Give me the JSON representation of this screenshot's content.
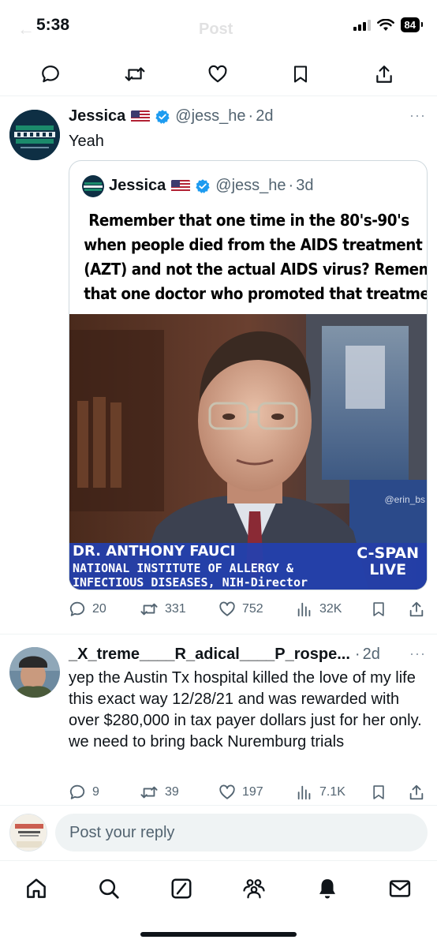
{
  "status_bar": {
    "time": "5:38",
    "battery": "84"
  },
  "ghost_header": {
    "back_glyph": "←",
    "title": "Post"
  },
  "action_bar": {
    "icons": [
      "comment-icon",
      "retweet-icon",
      "like-icon",
      "bookmark-icon",
      "share-icon"
    ]
  },
  "main_tweet": {
    "name": "Jessica",
    "handle": "@jess_he",
    "age": "2d",
    "text": "Yeah",
    "quote": {
      "name": "Jessica",
      "handle": "@jess_he",
      "age": "3d",
      "caption_lines": [
        "Remember that one time in the 80's-90's",
        "when people died from the AIDS treatment",
        "(AZT) and not the actual AIDS virus?  Remember",
        "that one doctor who promoted that treatment?"
      ],
      "photo": {
        "watermark": "@erin_bs",
        "lower_third": [
          "DR. ANTHONY FAUCI",
          "NATIONAL INSTITUTE OF ALLERGY &",
          "INFECTIOUS DISEASES, NIH-Director"
        ],
        "network": [
          "C-SPAN",
          "LIVE"
        ]
      }
    },
    "stats": {
      "replies": "20",
      "reposts": "331",
      "likes": "752",
      "views": "32K"
    }
  },
  "reply_tweet": {
    "name": "_X_treme____R_adical____P_rospe...",
    "age": "2d",
    "text": "yep the Austin Tx hospital killed the love of my life this exact way 12/28/21 and was rewarded with over $280,000 in tax payer dollars just for her only. we need to bring back Nuremburg trials",
    "stats": {
      "replies": "9",
      "reposts": "39",
      "likes": "197",
      "views": "7.1K"
    }
  },
  "reply_composer": {
    "placeholder": "Post your reply"
  },
  "tab_bar": {
    "icons": [
      "home-icon",
      "search-icon",
      "grok-icon",
      "communities-icon",
      "notifications-icon",
      "messages-icon"
    ]
  },
  "colors": {
    "secondary_text": "#536471",
    "verified_blue": "#1d9bf0",
    "divider": "#eff3f4"
  }
}
